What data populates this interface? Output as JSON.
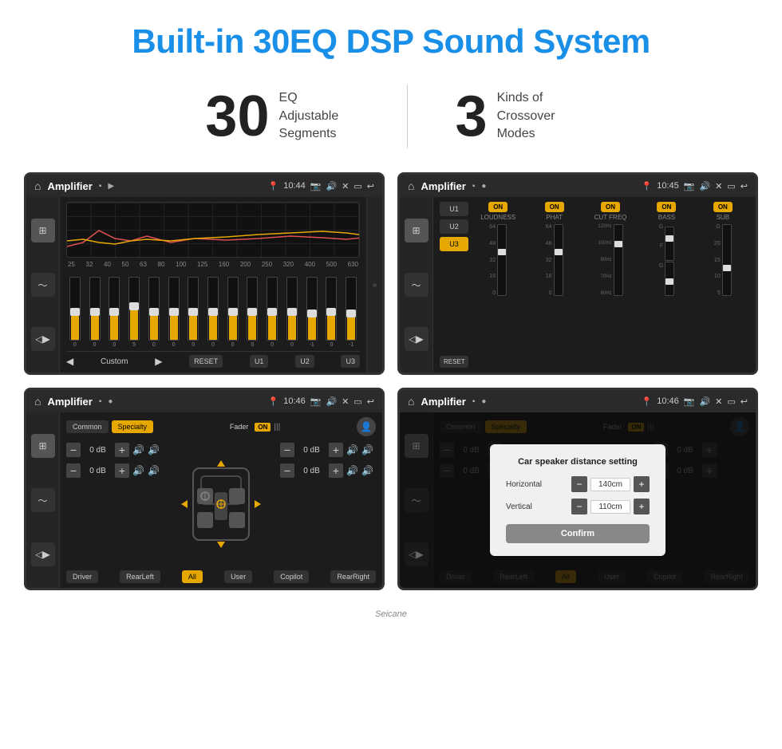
{
  "page": {
    "title": "Built-in 30EQ DSP Sound System",
    "stat1_number": "30",
    "stat1_text_line1": "EQ Adjustable",
    "stat1_text_line2": "Segments",
    "stat2_number": "3",
    "stat2_text_line1": "Kinds of",
    "stat2_text_line2": "Crossover Modes"
  },
  "screen_tl": {
    "title": "Amplifier",
    "time": "10:44",
    "eq_labels": [
      "25",
      "32",
      "40",
      "50",
      "63",
      "80",
      "100",
      "125",
      "160",
      "200",
      "250",
      "320",
      "400",
      "500",
      "630"
    ],
    "fader_values": [
      "0",
      "0",
      "0",
      "5",
      "0",
      "0",
      "0",
      "0",
      "0",
      "0",
      "0",
      "0",
      "-1",
      "0",
      "-1"
    ],
    "bottom_btns": [
      "RESET",
      "U1",
      "U2",
      "U3"
    ],
    "current_preset": "Custom"
  },
  "screen_tr": {
    "title": "Amplifier",
    "time": "10:45",
    "presets": [
      "U1",
      "U2",
      "U3"
    ],
    "active_preset": "U3",
    "channels": [
      "LOUDNESS",
      "PHAT",
      "CUT FREQ",
      "BASS",
      "SUB"
    ],
    "reset_label": "RESET"
  },
  "screen_bl": {
    "title": "Amplifier",
    "time": "10:46",
    "tabs": [
      "Common",
      "Specialty"
    ],
    "active_tab": "Specialty",
    "fader_label": "Fader",
    "fader_on": "ON",
    "db_values": [
      "0 dB",
      "0 dB",
      "0 dB",
      "0 dB"
    ],
    "bottom_btns": [
      "Driver",
      "RearLeft",
      "All",
      "User",
      "Copilot",
      "RearRight"
    ]
  },
  "screen_br": {
    "title": "Amplifier",
    "time": "10:46",
    "tabs": [
      "Common",
      "Specialty"
    ],
    "dialog": {
      "title": "Car speaker distance setting",
      "horizontal_label": "Horizontal",
      "horizontal_value": "140cm",
      "vertical_label": "Vertical",
      "vertical_value": "110cm",
      "confirm_label": "Confirm"
    },
    "db_values": [
      "0 dB",
      "0 dB"
    ],
    "bottom_btns": [
      "Driver",
      "RearLeft",
      "All",
      "User",
      "Copilot",
      "RearRight"
    ]
  },
  "watermark": "Seicane"
}
